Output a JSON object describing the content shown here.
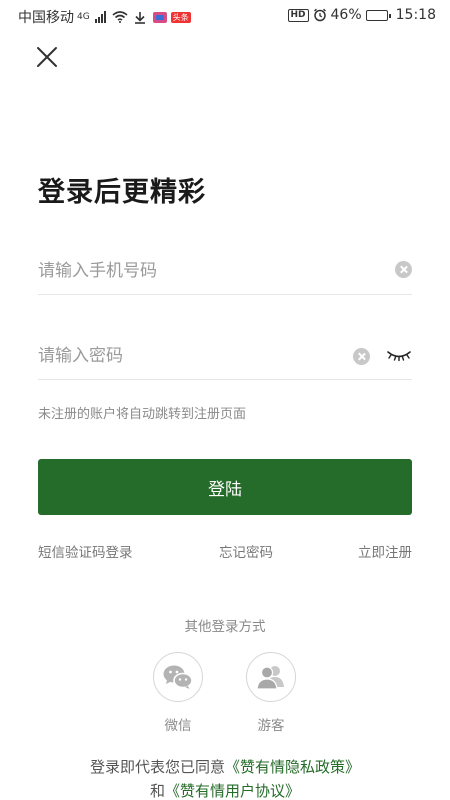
{
  "status_bar": {
    "carrier": "中国移动",
    "network": "4G",
    "battery_text": "46%",
    "battery_level": 0.46,
    "time": "15:18",
    "hd_badge": "HD",
    "notif_badge": "头条"
  },
  "headline": "登录后更精彩",
  "phone_field": {
    "placeholder": "请输入手机号码",
    "value": ""
  },
  "password_field": {
    "placeholder": "请输入密码",
    "value": ""
  },
  "hint": "未注册的账户将自动跳转到注册页面",
  "login_button": "登陆",
  "links": {
    "sms_login": "短信验证码登录",
    "forgot_password": "忘记密码",
    "register": "立即注册"
  },
  "other_login": {
    "title": "其他登录方式",
    "wechat": "微信",
    "guest": "游客"
  },
  "agreement": {
    "prefix": "登录即代表您已同意",
    "privacy_link": "《赞有情隐私政策》",
    "and_text": "和",
    "user_agreement_link": "《赞有情用户协议》"
  },
  "colors": {
    "primary": "#256b29",
    "hint_gray": "#8a8a8a"
  }
}
